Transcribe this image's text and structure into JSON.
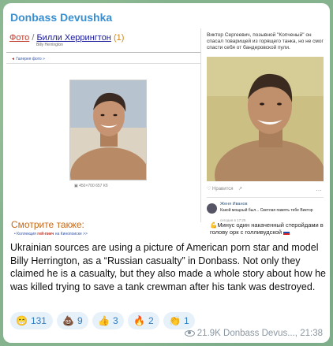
{
  "channel": {
    "name": "Donbass Devushka"
  },
  "left_page": {
    "crumb_photo": "Фото",
    "crumb_sep": " / ",
    "crumb_title": "Билли Херрингтон",
    "crumb_count": "(1)",
    "crumb_sub": "Billy Herrington",
    "back_link": "Галерея фото »",
    "photo_size": "450×700 657 Кб",
    "see_also": "Смотрите также:",
    "collection_pre": "Коллекция",
    "collection_bold": "гей-пикч",
    "collection_post": "на Кинопоиске >>"
  },
  "right_post": {
    "caption": "Виктор Сергеевич, позывной \"Копченый\" он спасал товарищей из горящего танка, но не смог спасти себя от бандеровской пули.",
    "like_label": "Нравится",
    "share_label": "↗",
    "more_label": "…",
    "comment_author": "Женя Иванов",
    "comment_text": "Какой мощный был... Светлая память тебе Виктор",
    "comment_time": "сегодня в 17:25",
    "second_comment": "Минус один накаченный стеройдами в голову орк с голливудской"
  },
  "message": {
    "text": "Ukrainian sources are using a picture of American porn star and model Billy Herrington, as a “Russian casualty” in Donbass. Not only they claimed he is a casualty, but they also made a whole story about how he was killed trying to save a tank crewman after his tank was destroyed."
  },
  "reactions": [
    {
      "emoji": "😁",
      "count": "131"
    },
    {
      "emoji": "💩",
      "count": "9"
    },
    {
      "emoji": "👍",
      "count": "3"
    },
    {
      "emoji": "🔥",
      "count": "2"
    },
    {
      "emoji": "👏",
      "count": "1"
    }
  ],
  "meta": {
    "views": "21.9K",
    "author": "Donbass Devus...,",
    "time": "21:38"
  },
  "colors": {
    "channel": "#3a8fd1",
    "reaction_bg": "#e6f1fa",
    "reaction_text": "#2f7cc0"
  }
}
